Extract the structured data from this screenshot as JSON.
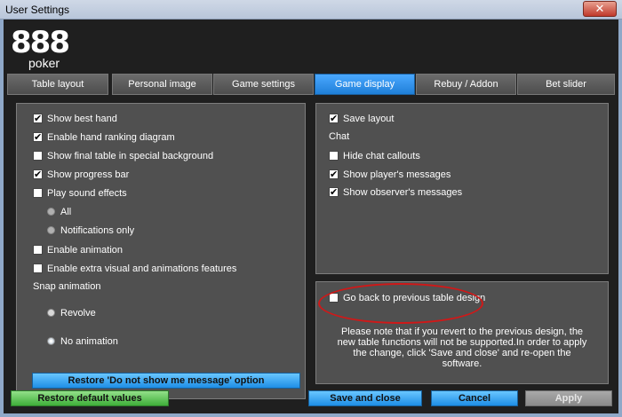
{
  "window": {
    "title": "User Settings",
    "close_label": "✕"
  },
  "logo": {
    "brand_number": "888",
    "brand_word": "poker"
  },
  "tabs": [
    {
      "label": "Table layout"
    },
    {
      "label": "Personal image"
    },
    {
      "label": "Game settings"
    },
    {
      "label": "Game display",
      "active": true
    },
    {
      "label": "Rebuy / Addon"
    },
    {
      "label": "Bet slider"
    }
  ],
  "left_panel": {
    "show_best_hand": {
      "label": "Show best hand",
      "checked": true
    },
    "enable_hand_ranking": {
      "label": "Enable hand ranking diagram",
      "checked": true
    },
    "show_final_table": {
      "label": "Show final table in special background",
      "checked": false
    },
    "show_progress_bar": {
      "label": "Show progress bar",
      "checked": true
    },
    "play_sound_effects": {
      "label": "Play sound effects",
      "checked": false
    },
    "sound_all": {
      "label": "All"
    },
    "sound_notifications": {
      "label": "Notifications only"
    },
    "enable_animation": {
      "label": "Enable animation",
      "checked": false
    },
    "enable_extra_visual": {
      "label": "Enable extra visual and animations features",
      "checked": false
    },
    "snap_animation_label": "Snap animation",
    "snap_revolve": {
      "label": "Revolve"
    },
    "snap_no_animation": {
      "label": "No animation",
      "selected": true
    },
    "restore_message_button": "Restore 'Do not show me message' option"
  },
  "right_panel": {
    "save_layout": {
      "label": "Save layout",
      "checked": true
    },
    "chat_heading": "Chat",
    "hide_chat_callouts": {
      "label": "Hide chat callouts",
      "checked": false
    },
    "show_player_messages": {
      "label": "Show player's messages",
      "checked": true
    },
    "show_observer_messages": {
      "label": "Show observer's messages",
      "checked": true
    },
    "go_back_previous_design": {
      "label": "Go back to previous table design",
      "checked": false
    },
    "note": "Please note that if you revert to the previous design, the new table functions will not be supported.In order to apply the change, click 'Save and close' and re-open the software."
  },
  "footer": {
    "restore_defaults": "Restore default values",
    "save_and_close": "Save and close",
    "cancel": "Cancel",
    "apply": "Apply"
  },
  "colors": {
    "accent_blue": "#1e8ee6",
    "green": "#3fae3a",
    "panel_bg": "#505050",
    "annotation_red": "#d01818"
  }
}
